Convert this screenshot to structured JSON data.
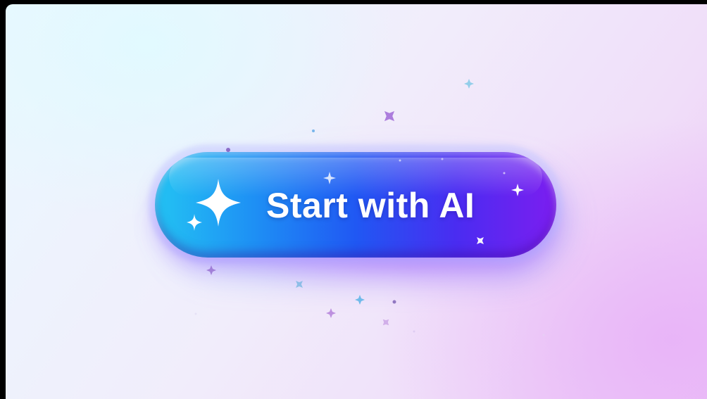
{
  "button": {
    "label": "Start with AI",
    "icon": "sparkle-icon",
    "gradient": [
      "#23c3f3",
      "#1e8ff4",
      "#2058f3",
      "#4a2cf1",
      "#7c1ef0"
    ],
    "text_color": "#ffffff"
  },
  "background": {
    "colors": [
      "#eaf8ff",
      "#f1edfb",
      "#f0def9",
      "#ecc6f6"
    ]
  },
  "decorations": {
    "icon": "sparkle-icon",
    "colors": [
      "#9a5fd6",
      "#6fc6e8",
      "#ffffff",
      "#b78ae3"
    ]
  }
}
